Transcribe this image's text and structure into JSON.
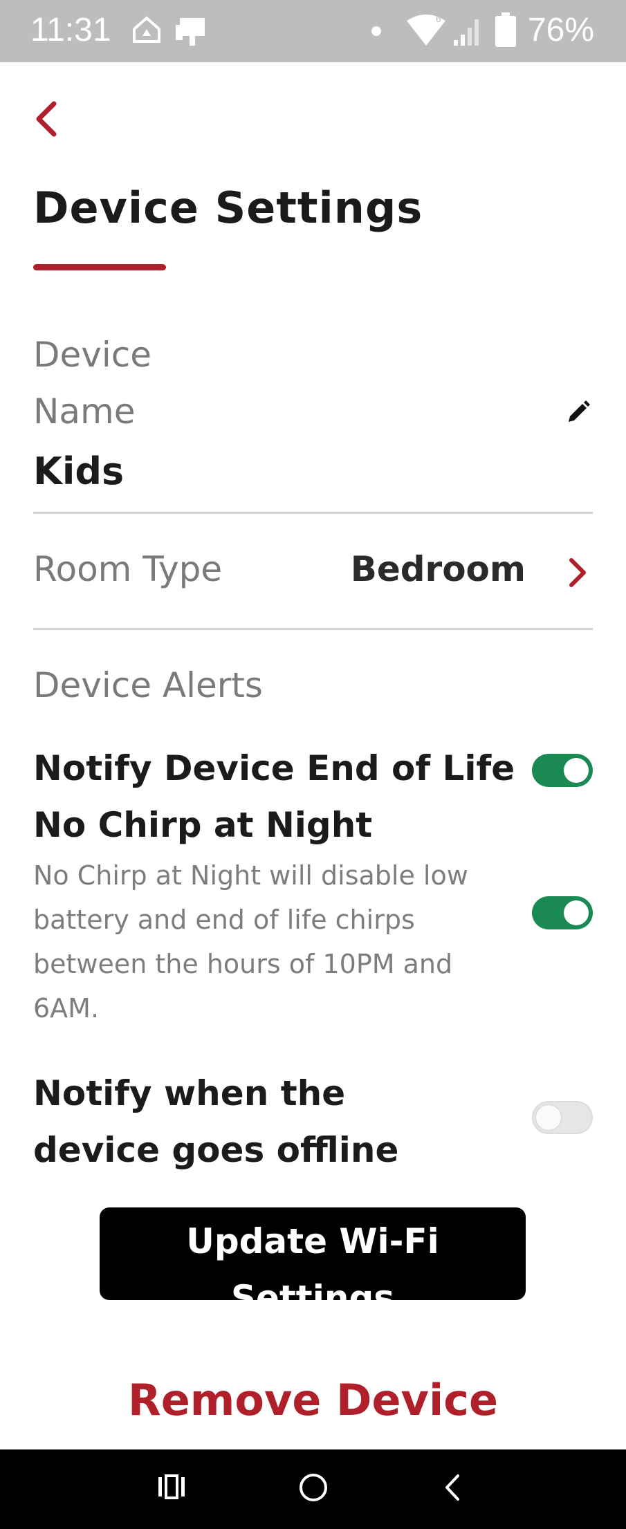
{
  "status_bar": {
    "time": "11:31",
    "battery": "76%"
  },
  "page": {
    "title": "Device Settings"
  },
  "device_name": {
    "label": "Device Name",
    "value": "Kids"
  },
  "room_type": {
    "label": "Room Type",
    "value": "Bedroom"
  },
  "alerts": {
    "heading": "Device Alerts",
    "end_of_life": {
      "label": "Notify Device End of Life",
      "enabled": true
    },
    "no_chirp": {
      "label": "No Chirp at Night",
      "description": "No Chirp at Night will disable low battery and end of life chirps between the hours of 10PM and 6AM.",
      "enabled": true
    },
    "offline": {
      "label": "Notify when the device goes offline",
      "enabled": false
    }
  },
  "buttons": {
    "update_wifi": "Update Wi-Fi Settings",
    "remove": "Remove Device"
  },
  "colors": {
    "accent": "#b0202a",
    "toggle_on": "#1a8a52",
    "status_bar": "#bdbdbd"
  },
  "icons": [
    "back-chevron-icon",
    "pencil-icon",
    "chevron-right-icon",
    "wifi-icon",
    "signal-icon",
    "battery-icon",
    "nav-recents-icon",
    "nav-home-icon",
    "nav-back-icon"
  ]
}
